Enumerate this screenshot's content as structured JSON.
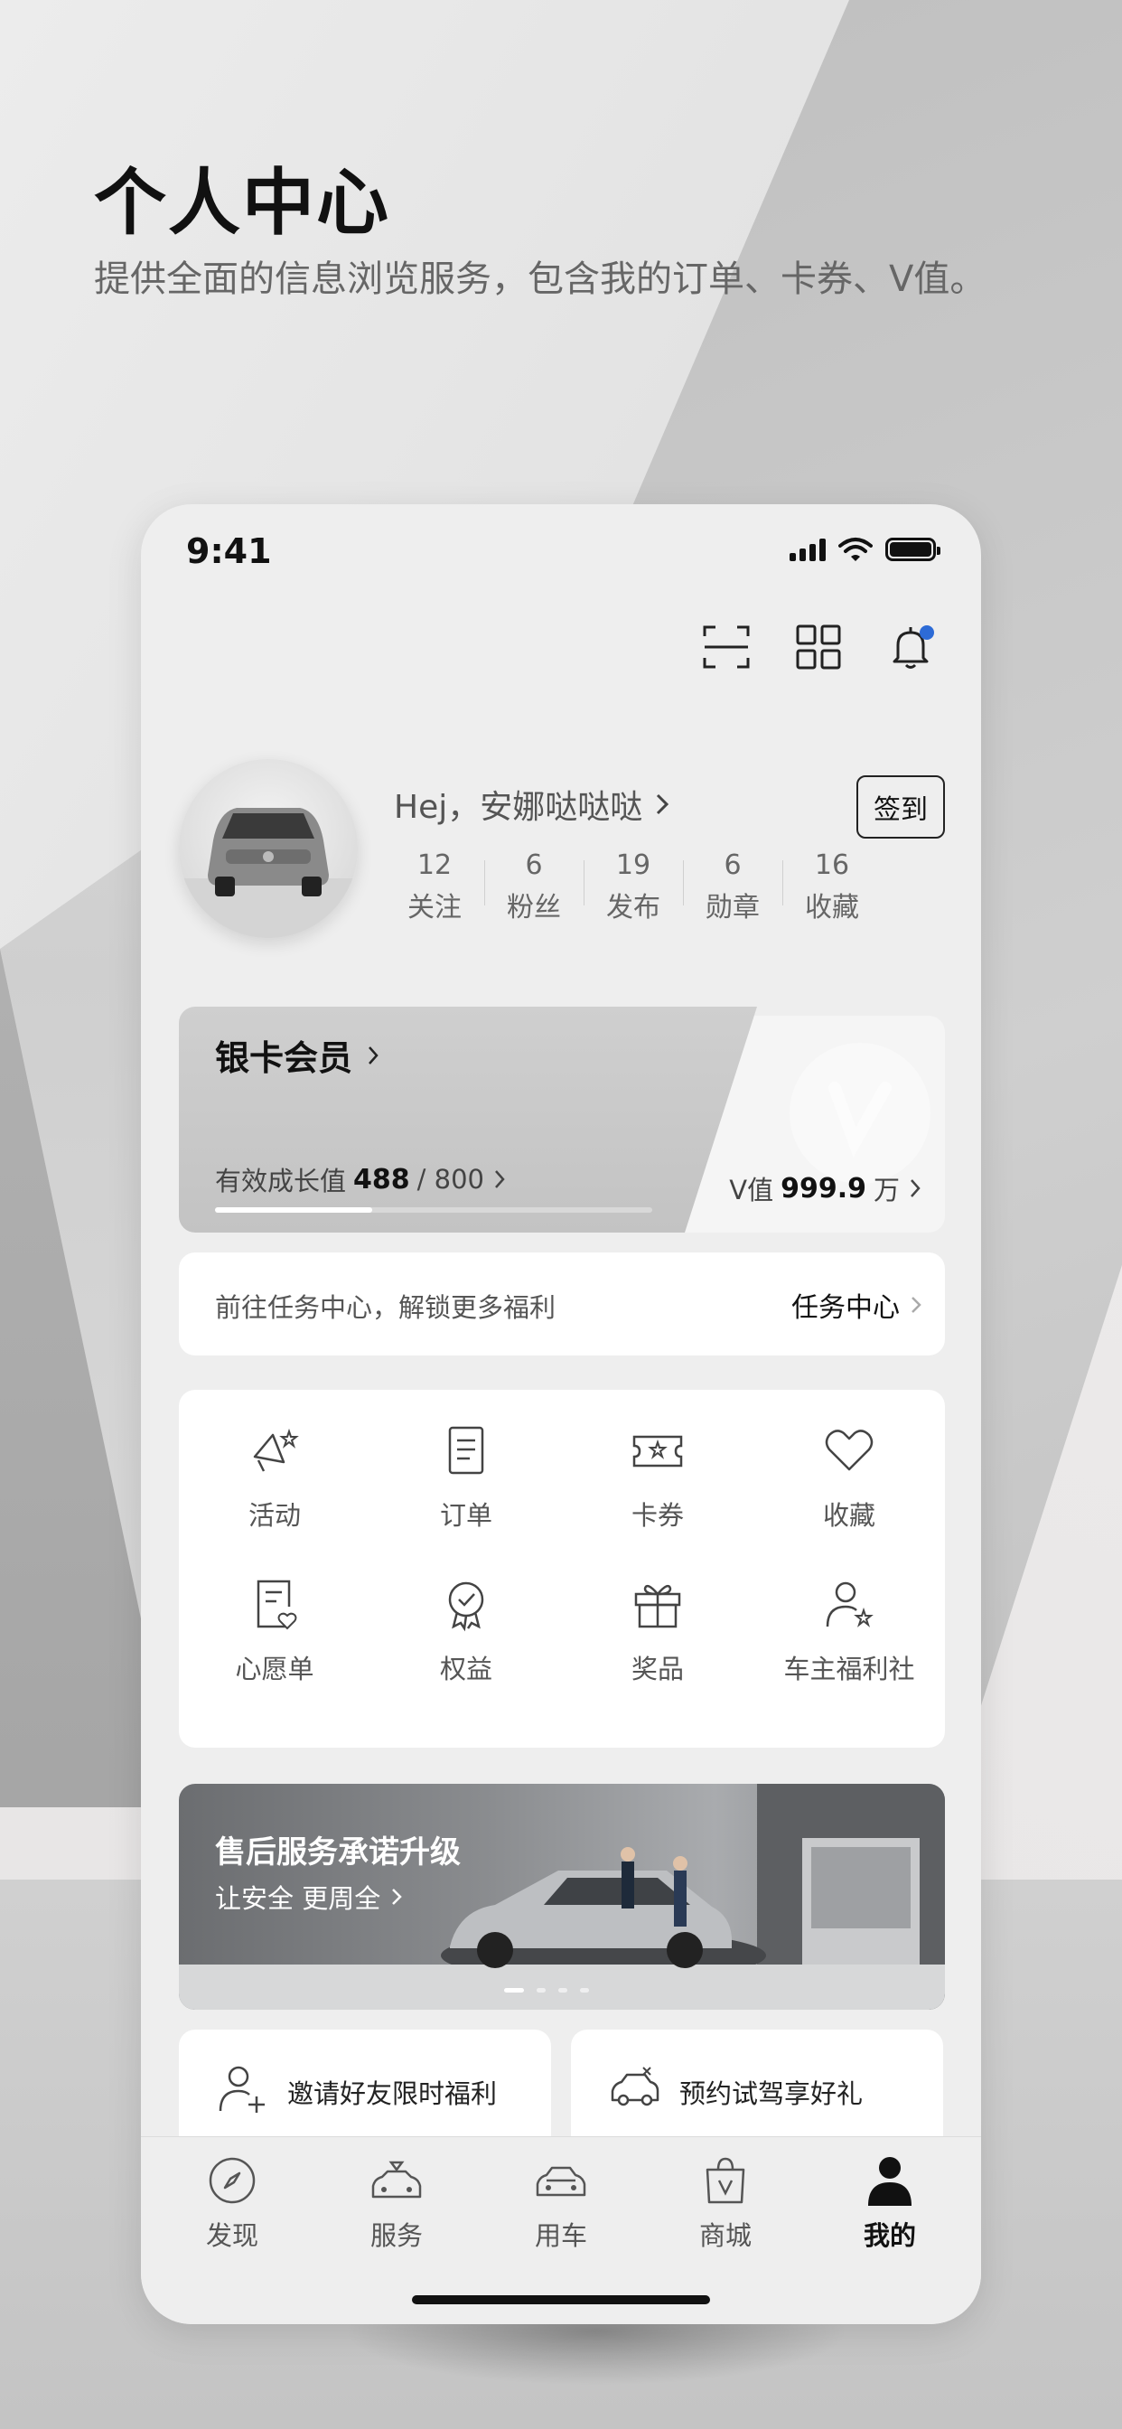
{
  "hero": {
    "title": "个人中心",
    "subtitle": "提供全面的信息浏览服务，包含我的订单、卡券、V值。"
  },
  "status_bar": {
    "time": "9:41"
  },
  "top_actions": [
    "scan-icon",
    "qr-grid-icon",
    "bell-icon"
  ],
  "profile": {
    "greeting": "Hej，安娜哒哒哒",
    "signin_label": "签到",
    "stats": [
      {
        "num": "12",
        "label": "关注"
      },
      {
        "num": "6",
        "label": "粉丝"
      },
      {
        "num": "19",
        "label": "发布"
      },
      {
        "num": "6",
        "label": "勋章"
      },
      {
        "num": "16",
        "label": "收藏"
      }
    ]
  },
  "member": {
    "title": "银卡会员",
    "growth_label": "有效成长值",
    "growth_value": "488",
    "growth_total": "/ 800",
    "growth_progress": 0.36,
    "v_label": "V值",
    "v_value": "999.9",
    "v_unit": "万"
  },
  "task": {
    "text": "前往任务中心，解锁更多福利",
    "link": "任务中心"
  },
  "grid_items": [
    {
      "label": "活动",
      "icon": "megaphone-star-icon"
    },
    {
      "label": "订单",
      "icon": "order-document-icon"
    },
    {
      "label": "卡券",
      "icon": "coupon-ticket-icon"
    },
    {
      "label": "收藏",
      "icon": "heart-icon"
    },
    {
      "label": "心愿单",
      "icon": "wishlist-icon"
    },
    {
      "label": "权益",
      "icon": "badge-check-icon"
    },
    {
      "label": "奖品",
      "icon": "gift-icon"
    },
    {
      "label": "车主福利社",
      "icon": "user-star-icon"
    }
  ],
  "banner": {
    "title": "售后服务承诺升级",
    "subtitle": "让安全 更周全"
  },
  "promos": [
    {
      "label": "邀请好友限时福利",
      "icon": "invite-user-icon"
    },
    {
      "label": "预约试驾享好礼",
      "icon": "test-drive-car-icon"
    }
  ],
  "tabs": [
    {
      "label": "发现",
      "icon": "compass-icon"
    },
    {
      "label": "服务",
      "icon": "service-car-icon"
    },
    {
      "label": "用车",
      "icon": "car-icon"
    },
    {
      "label": "商城",
      "icon": "shopping-bag-icon"
    },
    {
      "label": "我的",
      "icon": "person-icon",
      "active": true
    }
  ],
  "colors": {
    "notification_dot": "#2d6bd6",
    "accent": "#111111"
  }
}
